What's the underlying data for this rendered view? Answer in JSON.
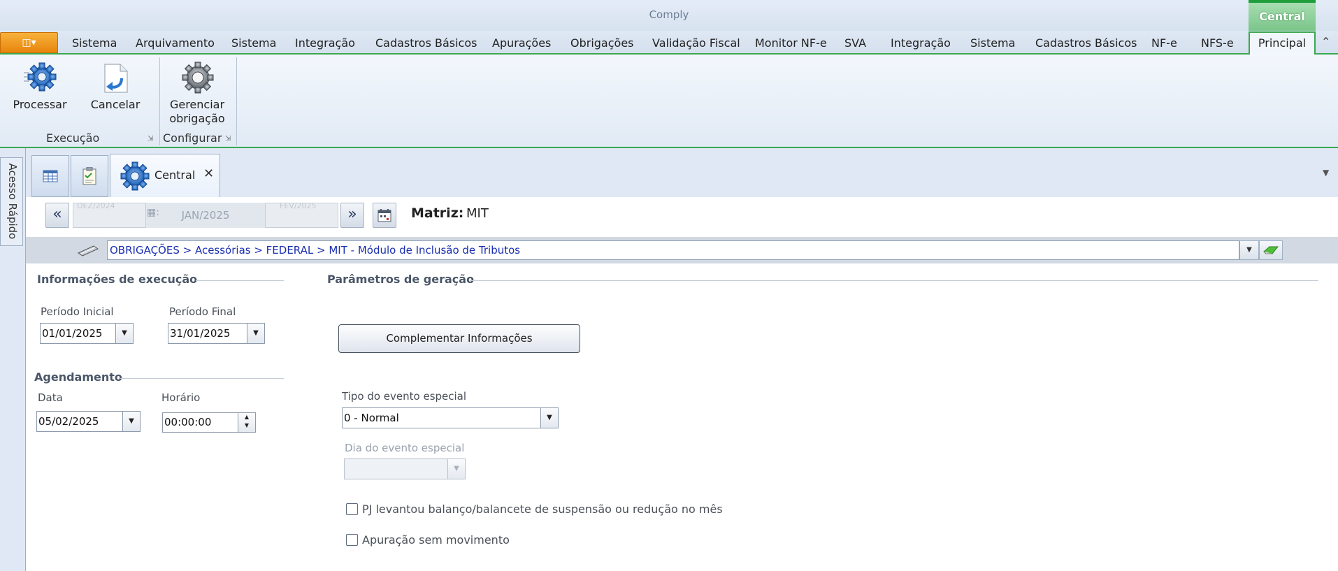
{
  "app": {
    "title": "Comply",
    "context_tab": "Central"
  },
  "menu": {
    "items": [
      "Sistema",
      "Arquivamento",
      "Sistema",
      "Integração",
      "Cadastros Básicos",
      "Apurações",
      "Obrigações",
      "Validação Fiscal",
      "Monitor NF-e",
      "SVA",
      "Integração",
      "Sistema",
      "Cadastros Básicos",
      "NF-e",
      "NFS-e"
    ],
    "active_tab": "Principal"
  },
  "ribbon": {
    "groups": [
      {
        "label": "Execução",
        "buttons": [
          "Processar",
          "Cancelar"
        ]
      },
      {
        "label": "Configurar",
        "buttons": [
          "Gerenciar obrigação"
        ]
      }
    ],
    "gerenciar_line1": "Gerenciar",
    "gerenciar_line2": "obrigação"
  },
  "quick_access": {
    "label": "Acesso Rápido"
  },
  "doc_tabs": {
    "active": "Central"
  },
  "nav": {
    "period": "JAN/2025",
    "period_prev_ghost": "DEZ/2024",
    "period_next_ghost": "FEV/2025",
    "matriz_label": "Matriz:",
    "matriz_value": "MIT"
  },
  "path": {
    "value": "OBRIGAÇÕES > Acessórias > FEDERAL > MIT - Módulo de Inclusão de Tributos"
  },
  "execucao": {
    "title": "Informações de execução",
    "periodo_inicial_label": "Período  Inicial",
    "periodo_inicial_value": "01/01/2025",
    "periodo_final_label": "Período Final",
    "periodo_final_value": "31/01/2025"
  },
  "agendamento": {
    "title": "Agendamento",
    "data_label": "Data",
    "data_value": "05/02/2025",
    "horario_label": "Horário",
    "horario_value": "00:00:00"
  },
  "geracao": {
    "title": "Parâmetros de geração",
    "complement_button": "Complementar Informações",
    "tipo_evento_label": "Tipo do evento especial",
    "tipo_evento_value": "0 - Normal",
    "dia_evento_label": "Dia do evento especial",
    "dia_evento_value": "",
    "checkbox_balanco": "PJ levantou balanço/balancete de suspensão ou redução no mês",
    "checkbox_balanco_checked": false,
    "checkbox_sem_movimento": "Apuração sem movimento",
    "checkbox_sem_movimento_checked": false
  }
}
